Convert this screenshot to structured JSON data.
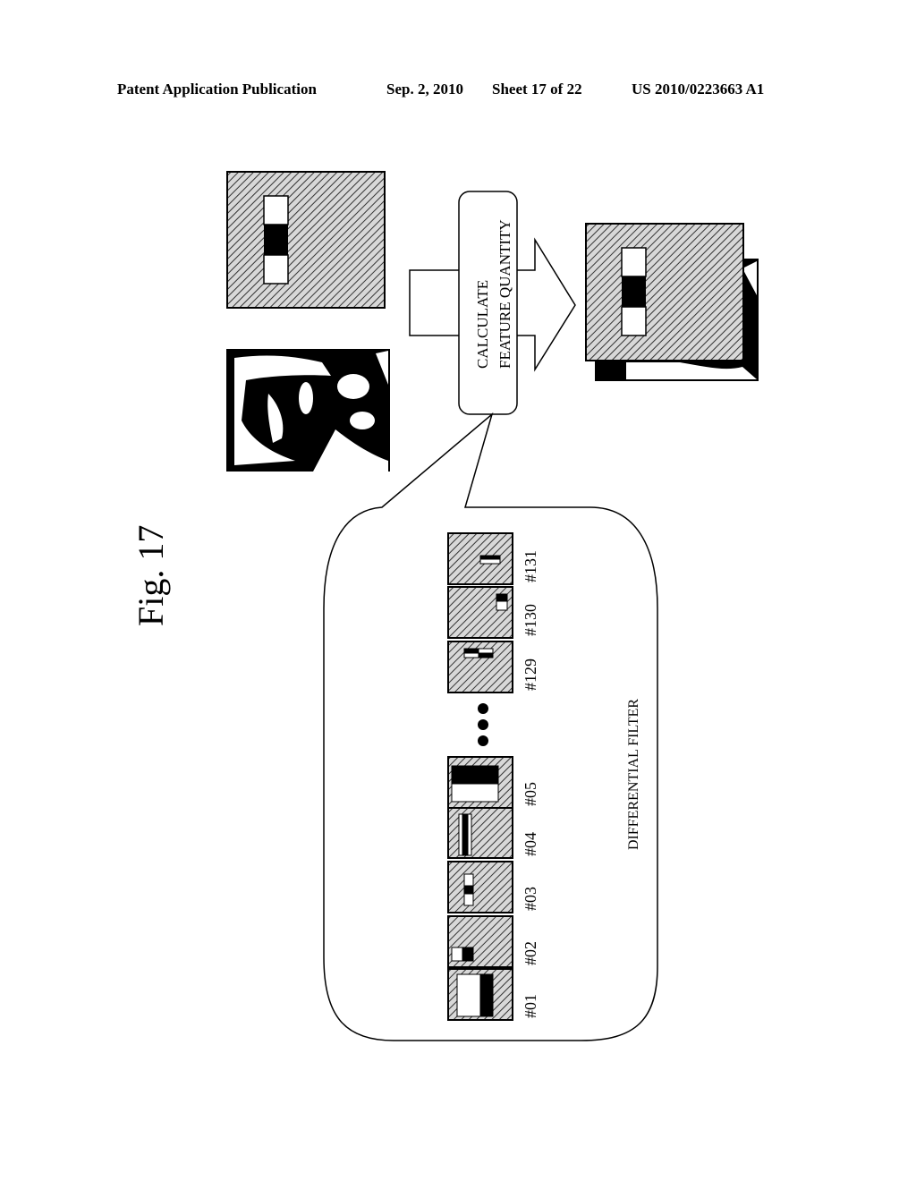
{
  "header": {
    "publication": "Patent Application Publication",
    "date": "Sep. 2, 2010",
    "sheet": "Sheet 17 of 22",
    "number": "US 2010/0223663 A1"
  },
  "figure": {
    "label": "Fig. 17",
    "process_label_line1": "CALCULATE",
    "process_label_line2": "FEATURE QUANTITY",
    "callout_caption": "DIFFERENTIAL FILTER",
    "ellipsis": "•••",
    "filters": [
      {
        "id": "#01",
        "pattern": "white-black-vertical-split"
      },
      {
        "id": "#02",
        "pattern": "small-white-black-corner"
      },
      {
        "id": "#03",
        "pattern": "white-black-white-small"
      },
      {
        "id": "#04",
        "pattern": "thin-stripes"
      },
      {
        "id": "#05",
        "pattern": "black-white-horizontal-split"
      },
      {
        "id": "#129",
        "pattern": "small-horizontal-pair"
      },
      {
        "id": "#130",
        "pattern": "small-corner-pair"
      },
      {
        "id": "#131",
        "pattern": "small-bar"
      }
    ],
    "inputs": [
      "filter-window",
      "face-image"
    ],
    "output": "filtered-face-stack"
  }
}
